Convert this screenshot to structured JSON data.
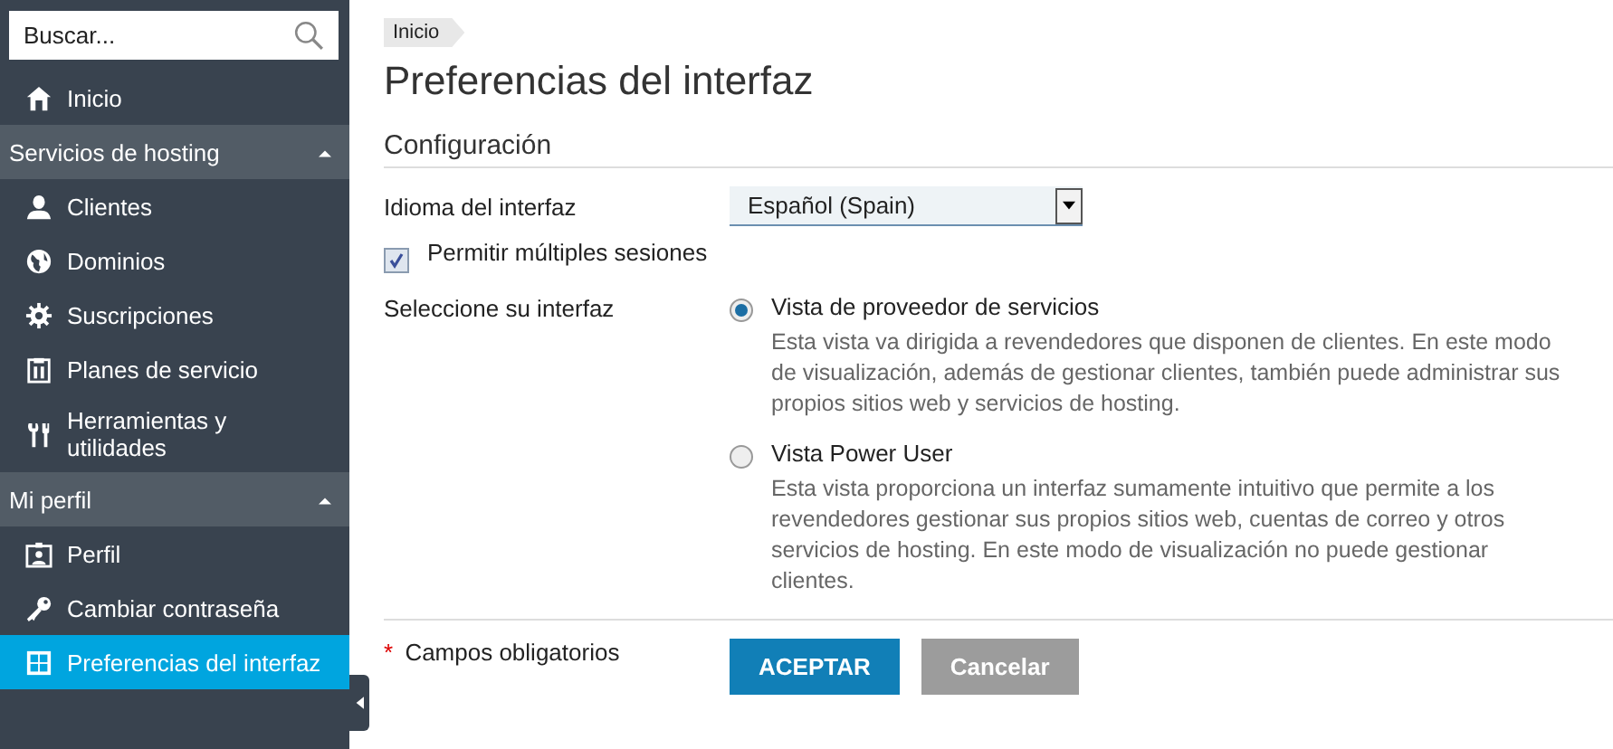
{
  "sidebar": {
    "search": {
      "placeholder": "Buscar..."
    },
    "items": [
      {
        "label": "Inicio",
        "selected": false
      }
    ],
    "groups": [
      {
        "title": "Servicios de hosting",
        "expanded": true,
        "items": [
          {
            "label": "Clientes",
            "selected": false
          },
          {
            "label": "Dominios",
            "selected": false
          },
          {
            "label": "Suscripciones",
            "selected": false
          },
          {
            "label": "Planes de servicio",
            "selected": false
          },
          {
            "label": "Herramientas y utilidades",
            "selected": false
          }
        ]
      },
      {
        "title": "Mi perfil",
        "expanded": true,
        "items": [
          {
            "label": "Perfil",
            "selected": false
          },
          {
            "label": "Cambiar contraseña",
            "selected": false
          },
          {
            "label": "Preferencias del interfaz",
            "selected": true
          }
        ]
      }
    ]
  },
  "breadcrumb": [
    "Inicio"
  ],
  "title": "Preferencias del interfaz",
  "section": "Configuración",
  "language": {
    "label": "Idioma del interfaz",
    "value": "Español (Spain)"
  },
  "multiple_sessions": {
    "label": "Permitir múltiples sesiones",
    "checked": true
  },
  "interface": {
    "label": "Seleccione su interfaz",
    "options": [
      {
        "label": "Vista de proveedor de servicios",
        "description": "Esta vista va dirigida a revendedores que disponen de clientes. En este modo de visualización, además de gestionar clientes, también puede administrar sus propios sitios web y servicios de hosting.",
        "selected": true
      },
      {
        "label": "Vista Power User",
        "description": "Esta vista proporciona un interfaz sumamente intuitivo que permite a los revendedores gestionar sus propios sitios web, cuentas de correo y otros servicios de hosting. En este modo de visualización no puede gestionar clientes.",
        "selected": false
      }
    ]
  },
  "required_note": {
    "mark": "*",
    "label": "Campos obligatorios"
  },
  "buttons": [
    {
      "label": "ACEPTAR",
      "kind": "primary"
    },
    {
      "label": "Cancelar",
      "kind": "secondary"
    }
  ]
}
